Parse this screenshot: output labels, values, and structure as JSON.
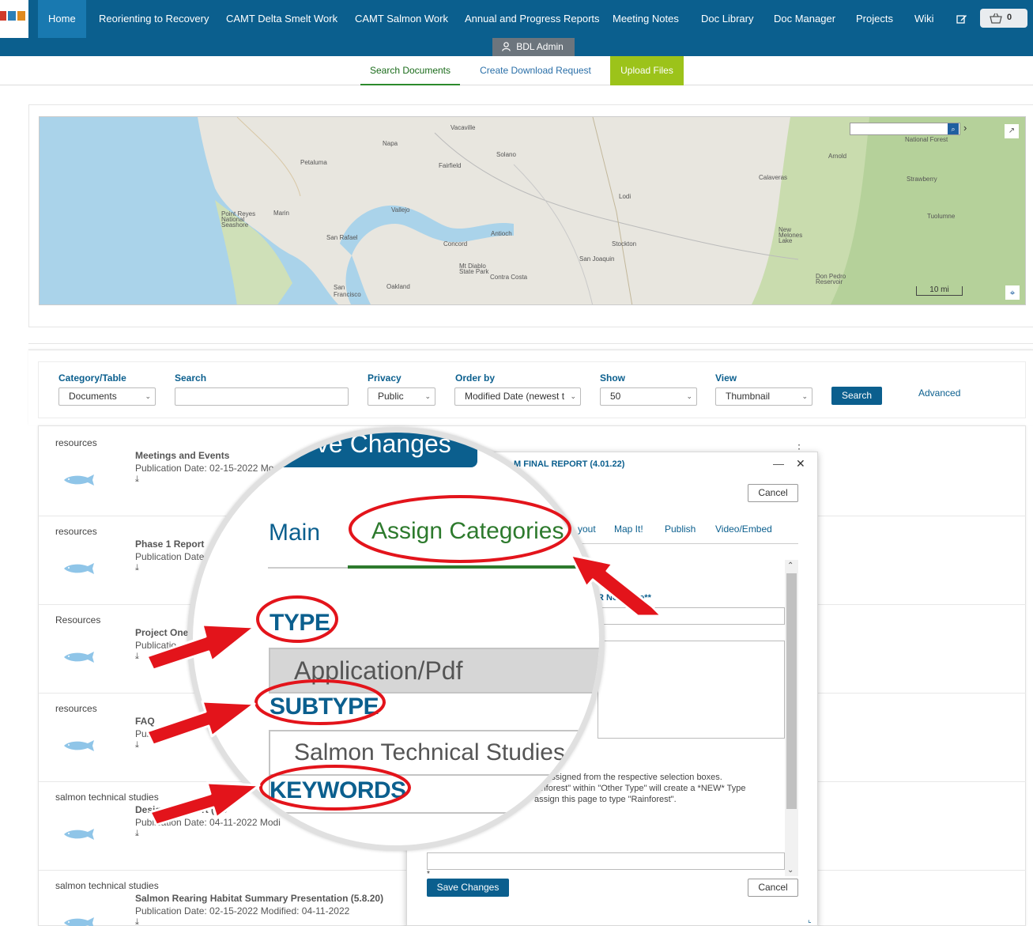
{
  "nav": {
    "items": [
      "Home",
      "Reorienting to Recovery",
      "CAMT Delta Smelt Work",
      "CAMT Salmon Work",
      "Annual and Progress Reports",
      "Meeting Notes",
      "Doc Library",
      "Doc Manager",
      "Projects",
      "Wiki"
    ],
    "cart_count": "0",
    "user": "BDL Admin",
    "colors": {
      "nav_bg": "#0b5f8e",
      "active_bg": "#1979b0"
    }
  },
  "doc_tabs": [
    "Search Documents",
    "Create Download Request",
    "Upload Files"
  ],
  "map": {
    "labels": [
      "Vacaville",
      "Napa",
      "Solano",
      "Fairfield",
      "Petaluma",
      "Lodi",
      "Vallejo",
      "Marin",
      "Point Reyes National Seashore",
      "San Rafael",
      "Antioch",
      "Concord",
      "Stockton",
      "Mt Diablo State Park",
      "Contra Costa",
      "San Joaquin",
      "San Francisco",
      "Oakland",
      "Arnold",
      "Calaveras",
      "Strawberry",
      "Tuolumne",
      "New Melones Lake",
      "Don Pedro Reservoir",
      "National Forest"
    ],
    "scale": "10 mi"
  },
  "filters": {
    "category_label": "Category/Table",
    "category_value": "Documents",
    "search_label": "Search",
    "search_value": "",
    "privacy_label": "Privacy",
    "privacy_value": "Public",
    "order_label": "Order by",
    "order_value": "Modified Date (newest t",
    "show_label": "Show",
    "show_value": "50",
    "view_label": "View",
    "view_value": "Thumbnail",
    "search_button": "Search",
    "advanced_link": "Advanced"
  },
  "results": [
    {
      "category": "resources",
      "title": "Meetings and Events",
      "date": "Publication Date: 02-15-2022 Modi"
    },
    {
      "category": "resources",
      "title": "Phase 1 Report",
      "date": "Publication Date"
    },
    {
      "category": "Resources",
      "title": "Project One",
      "date": "Publicatio"
    },
    {
      "category": "resources",
      "title": "FAQ",
      "date": "Publi             Date"
    },
    {
      "category": "salmon technical studies",
      "title": "Design T             Report (4.0",
      "date": "Publication Date: 04-11-2022 Modi"
    },
    {
      "category": "salmon technical studies",
      "title": "Salmon Rearing Habitat Summary Presentation (5.8.20)",
      "date": "Publication Date: 02-15-2022 Modified: 04-11-2022"
    }
  ],
  "modal": {
    "title": "M FINAL REPORT (4.01.22)",
    "cancel": "Cancel",
    "save": "Save Changes",
    "tabs": [
      "yout",
      "Map It!",
      "Publish",
      "Video/Embed"
    ],
    "label_fragment": "R New     type**",
    "note_lines": [
      "  be assigned from the respective selection boxes.",
      "ainforest\" within \"Other Type\" will create a *NEW* Type",
      "  assign this page to type \"Rainforest\"."
    ],
    "star": "*"
  },
  "magnifier": {
    "button_text": "ve Changes",
    "tab_main": "Main",
    "tab_assign": "Assign Categories",
    "type_label": "TYPE",
    "type_value": "Application/Pdf",
    "subtype_label": "SUBTYPE",
    "subtype_value": "Salmon Technical Studies",
    "keywords_label": "KEYWORDS"
  }
}
